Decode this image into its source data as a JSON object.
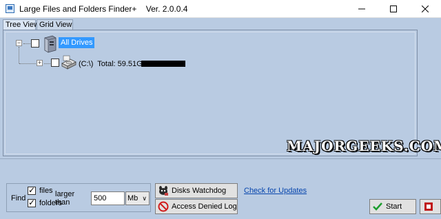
{
  "window": {
    "title": "Large Files and Folders Finder+    Ver. 2.0.0.4"
  },
  "tabs": [
    {
      "label": "Tree View",
      "active": true
    },
    {
      "label": "Grid View",
      "active": false
    }
  ],
  "tree": {
    "root": {
      "label": "All Drives",
      "expander": "−",
      "checked": false,
      "icon": "computer-icon"
    },
    "children": [
      {
        "label": "(C:\\)  Total: 59.51GB",
        "expander": "+",
        "checked": false,
        "icon": "hard-drive-icon",
        "usage_fraction": 1.0
      }
    ]
  },
  "watermark": "MAJORGEEKS.COM",
  "find": {
    "find_label": "Find",
    "files_label": "files",
    "files_checked": true,
    "folders_label": "folders",
    "folders_checked": true,
    "larger_than_label": "larger than",
    "size_value": "500",
    "unit_value": "Mb"
  },
  "buttons": {
    "watchdog_label": "Disks Watchdog",
    "watchdog_icon": "watchdog-icon",
    "denied_label": "Access Denied Log",
    "denied_icon": "no-entry-icon",
    "update_link": "Check for Updates",
    "start_label": "Start",
    "start_icon": "checkmark-icon",
    "stop_icon": "stop-icon"
  },
  "colors": {
    "background": "#b9cbe2",
    "selection": "#3399ff",
    "link": "#0645ad"
  }
}
